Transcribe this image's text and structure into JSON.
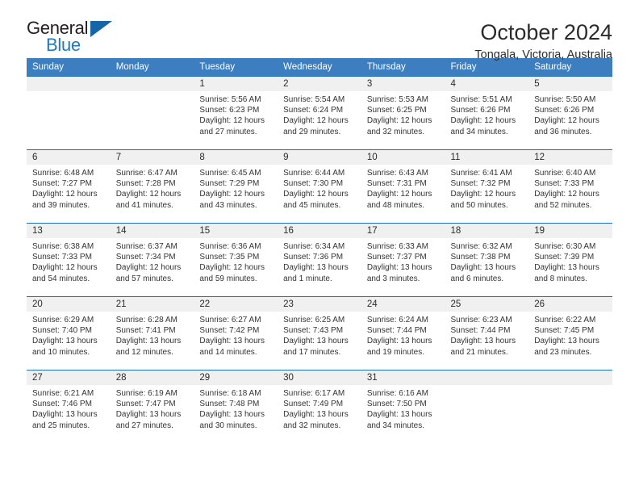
{
  "brand": {
    "name_top": "General",
    "name_bottom": "Blue",
    "triangle_color": "#1565a8",
    "blue_color": "#1f7ac4"
  },
  "header": {
    "title": "October 2024",
    "subtitle": "Tongala, Victoria, Australia"
  },
  "theme": {
    "header_row_bg": "#3c7ebf",
    "row_divider": "#1d6fb8",
    "daynum_band_bg": "#f0f0f0"
  },
  "calendar": {
    "weekday_headers": [
      "Sunday",
      "Monday",
      "Tuesday",
      "Wednesday",
      "Thursday",
      "Friday",
      "Saturday"
    ],
    "labels": {
      "sunrise": "Sunrise:",
      "sunset": "Sunset:",
      "daylight": "Daylight:"
    },
    "weeks": [
      [
        {
          "day": ""
        },
        {
          "day": ""
        },
        {
          "day": "1",
          "sunrise": "Sunrise: 5:56 AM",
          "sunset": "Sunset: 6:23 PM",
          "daylight_1": "Daylight: 12 hours",
          "daylight_2": "and 27 minutes."
        },
        {
          "day": "2",
          "sunrise": "Sunrise: 5:54 AM",
          "sunset": "Sunset: 6:24 PM",
          "daylight_1": "Daylight: 12 hours",
          "daylight_2": "and 29 minutes."
        },
        {
          "day": "3",
          "sunrise": "Sunrise: 5:53 AM",
          "sunset": "Sunset: 6:25 PM",
          "daylight_1": "Daylight: 12 hours",
          "daylight_2": "and 32 minutes."
        },
        {
          "day": "4",
          "sunrise": "Sunrise: 5:51 AM",
          "sunset": "Sunset: 6:26 PM",
          "daylight_1": "Daylight: 12 hours",
          "daylight_2": "and 34 minutes."
        },
        {
          "day": "5",
          "sunrise": "Sunrise: 5:50 AM",
          "sunset": "Sunset: 6:26 PM",
          "daylight_1": "Daylight: 12 hours",
          "daylight_2": "and 36 minutes."
        }
      ],
      [
        {
          "day": "6",
          "sunrise": "Sunrise: 6:48 AM",
          "sunset": "Sunset: 7:27 PM",
          "daylight_1": "Daylight: 12 hours",
          "daylight_2": "and 39 minutes."
        },
        {
          "day": "7",
          "sunrise": "Sunrise: 6:47 AM",
          "sunset": "Sunset: 7:28 PM",
          "daylight_1": "Daylight: 12 hours",
          "daylight_2": "and 41 minutes."
        },
        {
          "day": "8",
          "sunrise": "Sunrise: 6:45 AM",
          "sunset": "Sunset: 7:29 PM",
          "daylight_1": "Daylight: 12 hours",
          "daylight_2": "and 43 minutes."
        },
        {
          "day": "9",
          "sunrise": "Sunrise: 6:44 AM",
          "sunset": "Sunset: 7:30 PM",
          "daylight_1": "Daylight: 12 hours",
          "daylight_2": "and 45 minutes."
        },
        {
          "day": "10",
          "sunrise": "Sunrise: 6:43 AM",
          "sunset": "Sunset: 7:31 PM",
          "daylight_1": "Daylight: 12 hours",
          "daylight_2": "and 48 minutes."
        },
        {
          "day": "11",
          "sunrise": "Sunrise: 6:41 AM",
          "sunset": "Sunset: 7:32 PM",
          "daylight_1": "Daylight: 12 hours",
          "daylight_2": "and 50 minutes."
        },
        {
          "day": "12",
          "sunrise": "Sunrise: 6:40 AM",
          "sunset": "Sunset: 7:33 PM",
          "daylight_1": "Daylight: 12 hours",
          "daylight_2": "and 52 minutes."
        }
      ],
      [
        {
          "day": "13",
          "sunrise": "Sunrise: 6:38 AM",
          "sunset": "Sunset: 7:33 PM",
          "daylight_1": "Daylight: 12 hours",
          "daylight_2": "and 54 minutes."
        },
        {
          "day": "14",
          "sunrise": "Sunrise: 6:37 AM",
          "sunset": "Sunset: 7:34 PM",
          "daylight_1": "Daylight: 12 hours",
          "daylight_2": "and 57 minutes."
        },
        {
          "day": "15",
          "sunrise": "Sunrise: 6:36 AM",
          "sunset": "Sunset: 7:35 PM",
          "daylight_1": "Daylight: 12 hours",
          "daylight_2": "and 59 minutes."
        },
        {
          "day": "16",
          "sunrise": "Sunrise: 6:34 AM",
          "sunset": "Sunset: 7:36 PM",
          "daylight_1": "Daylight: 13 hours",
          "daylight_2": "and 1 minute."
        },
        {
          "day": "17",
          "sunrise": "Sunrise: 6:33 AM",
          "sunset": "Sunset: 7:37 PM",
          "daylight_1": "Daylight: 13 hours",
          "daylight_2": "and 3 minutes."
        },
        {
          "day": "18",
          "sunrise": "Sunrise: 6:32 AM",
          "sunset": "Sunset: 7:38 PM",
          "daylight_1": "Daylight: 13 hours",
          "daylight_2": "and 6 minutes."
        },
        {
          "day": "19",
          "sunrise": "Sunrise: 6:30 AM",
          "sunset": "Sunset: 7:39 PM",
          "daylight_1": "Daylight: 13 hours",
          "daylight_2": "and 8 minutes."
        }
      ],
      [
        {
          "day": "20",
          "sunrise": "Sunrise: 6:29 AM",
          "sunset": "Sunset: 7:40 PM",
          "daylight_1": "Daylight: 13 hours",
          "daylight_2": "and 10 minutes."
        },
        {
          "day": "21",
          "sunrise": "Sunrise: 6:28 AM",
          "sunset": "Sunset: 7:41 PM",
          "daylight_1": "Daylight: 13 hours",
          "daylight_2": "and 12 minutes."
        },
        {
          "day": "22",
          "sunrise": "Sunrise: 6:27 AM",
          "sunset": "Sunset: 7:42 PM",
          "daylight_1": "Daylight: 13 hours",
          "daylight_2": "and 14 minutes."
        },
        {
          "day": "23",
          "sunrise": "Sunrise: 6:25 AM",
          "sunset": "Sunset: 7:43 PM",
          "daylight_1": "Daylight: 13 hours",
          "daylight_2": "and 17 minutes."
        },
        {
          "day": "24",
          "sunrise": "Sunrise: 6:24 AM",
          "sunset": "Sunset: 7:44 PM",
          "daylight_1": "Daylight: 13 hours",
          "daylight_2": "and 19 minutes."
        },
        {
          "day": "25",
          "sunrise": "Sunrise: 6:23 AM",
          "sunset": "Sunset: 7:44 PM",
          "daylight_1": "Daylight: 13 hours",
          "daylight_2": "and 21 minutes."
        },
        {
          "day": "26",
          "sunrise": "Sunrise: 6:22 AM",
          "sunset": "Sunset: 7:45 PM",
          "daylight_1": "Daylight: 13 hours",
          "daylight_2": "and 23 minutes."
        }
      ],
      [
        {
          "day": "27",
          "sunrise": "Sunrise: 6:21 AM",
          "sunset": "Sunset: 7:46 PM",
          "daylight_1": "Daylight: 13 hours",
          "daylight_2": "and 25 minutes."
        },
        {
          "day": "28",
          "sunrise": "Sunrise: 6:19 AM",
          "sunset": "Sunset: 7:47 PM",
          "daylight_1": "Daylight: 13 hours",
          "daylight_2": "and 27 minutes."
        },
        {
          "day": "29",
          "sunrise": "Sunrise: 6:18 AM",
          "sunset": "Sunset: 7:48 PM",
          "daylight_1": "Daylight: 13 hours",
          "daylight_2": "and 30 minutes."
        },
        {
          "day": "30",
          "sunrise": "Sunrise: 6:17 AM",
          "sunset": "Sunset: 7:49 PM",
          "daylight_1": "Daylight: 13 hours",
          "daylight_2": "and 32 minutes."
        },
        {
          "day": "31",
          "sunrise": "Sunrise: 6:16 AM",
          "sunset": "Sunset: 7:50 PM",
          "daylight_1": "Daylight: 13 hours",
          "daylight_2": "and 34 minutes."
        },
        {
          "day": ""
        },
        {
          "day": ""
        }
      ]
    ]
  }
}
